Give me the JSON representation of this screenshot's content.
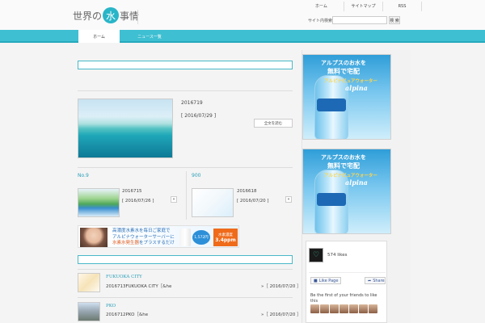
{
  "header": {
    "logo_pre": "世界の",
    "logo_mid": "水",
    "logo_post": "事情",
    "links": [
      "ホーム",
      "サイトマップ",
      "RSS"
    ],
    "search_label": "サイト内検索",
    "search_button": "検 索"
  },
  "nav": {
    "home": "ホーム",
    "news": "ニュース一覧"
  },
  "featured": {
    "title": "2016719",
    "date": "[ 2016/07/29 ]",
    "more": "全文を読む"
  },
  "cards": [
    {
      "category": "No.9",
      "title": "2016715",
      "date": "[ 2016/07/26 ]",
      "arrow": "»"
    },
    {
      "category": "900",
      "title": "2016618",
      "date": "[ 2016/07/20 ]",
      "arrow": "»"
    }
  ],
  "banner": {
    "line1": "高濃度水素水を毎日ご家庭で",
    "line2": "アルピナウォーターサーバーに",
    "line3_hl": "水素水発生器",
    "line3_rest": "をプラスするだけ",
    "badge": "1,572円",
    "value_top": "水素濃度",
    "value": "3.4ppm"
  },
  "list": [
    {
      "category": "FUKUOKA CITY",
      "text": "2016713FUKUOKA CITY［&he",
      "date": "»［ 2016/07/20 ］"
    },
    {
      "category": "PKO",
      "text": "2016712PKO［&he",
      "date": "»［ 2016/07/20 ］"
    }
  ],
  "ads": [
    {
      "line1": "アルプスのお水を",
      "line2": "無料で宅配",
      "line3": "アルピナピュアウォーター",
      "brand": "alpina"
    },
    {
      "line1": "アルプスのお水を",
      "line2": "無料で宅配",
      "line3": "アルピナピュアウォーター",
      "brand": "alpina"
    }
  ],
  "facebook": {
    "likes": "574 likes",
    "like_page": "Like Page",
    "share": "Share",
    "friends_text": "Be the first of your friends to like this"
  }
}
